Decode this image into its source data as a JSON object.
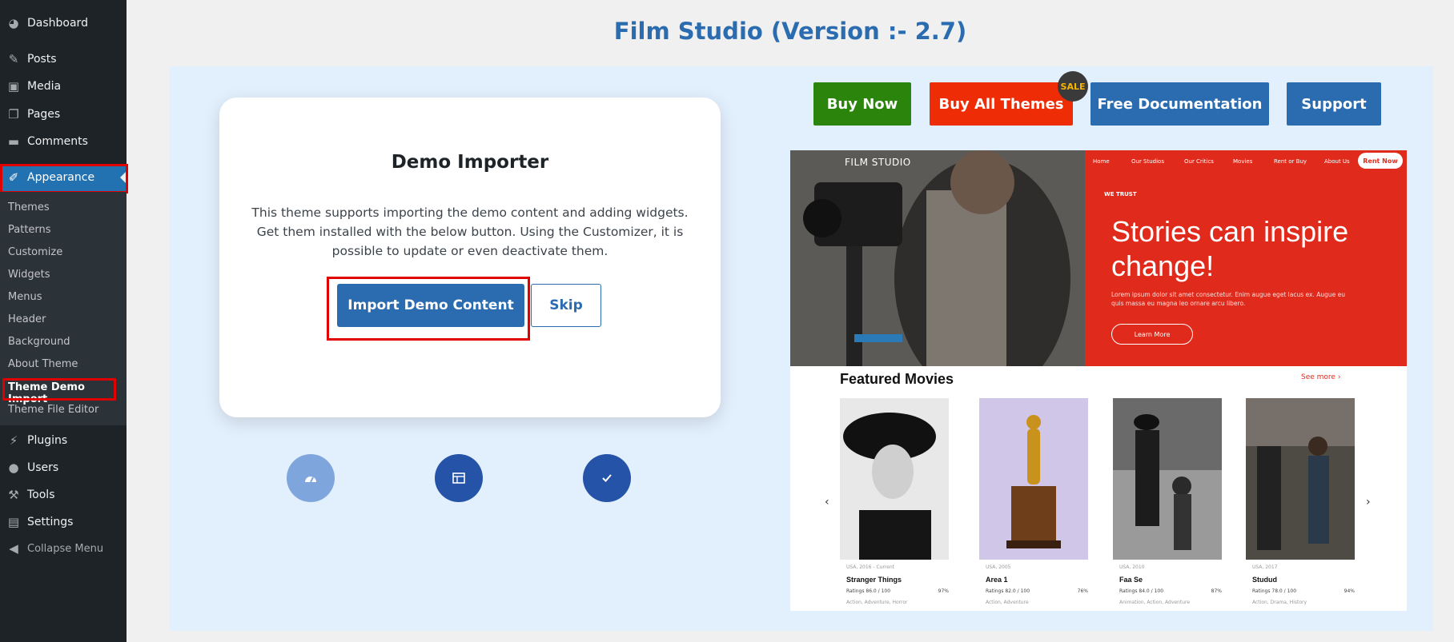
{
  "sidebar": {
    "menu": [
      {
        "label": "Dashboard",
        "icon": "dashboard-icon"
      },
      {
        "label": "Posts",
        "icon": "pin-icon"
      },
      {
        "label": "Media",
        "icon": "media-icon"
      },
      {
        "label": "Pages",
        "icon": "pages-icon"
      },
      {
        "label": "Comments",
        "icon": "comment-icon"
      },
      {
        "label": "Appearance",
        "icon": "brush-icon"
      }
    ],
    "submenu": [
      "Themes",
      "Patterns",
      "Customize",
      "Widgets",
      "Menus",
      "Header",
      "Background",
      "About Theme",
      "Theme Demo Import",
      "Theme File Editor"
    ],
    "menu2": [
      {
        "label": "Plugins",
        "icon": "plug-icon"
      },
      {
        "label": "Users",
        "icon": "user-icon"
      },
      {
        "label": "Tools",
        "icon": "wrench-icon"
      },
      {
        "label": "Settings",
        "icon": "settings-icon"
      }
    ],
    "collapse_label": "Collapse Menu"
  },
  "page_title": "Film Studio (Version :- 2.7)",
  "importer": {
    "title": "Demo Importer",
    "description": "This theme supports importing the demo content and adding widgets. Get them installed with the below button. Using the Customizer, it is possible to update or even deactivate them.",
    "import_label": "Import Demo Content",
    "skip_label": "Skip"
  },
  "steps": [
    {
      "icon": "gauge-icon"
    },
    {
      "icon": "table-icon"
    },
    {
      "icon": "check-icon"
    }
  ],
  "top_buttons": {
    "buy_now": "Buy Now",
    "buy_all": "Buy All Themes",
    "sale_badge": "SALE",
    "docs": "Free Documentation",
    "support": "Support"
  },
  "preview": {
    "logo": "FILM STUDIO",
    "nav": [
      "Home",
      "Our Studios",
      "Our Critics",
      "Movies",
      "Rent or Buy",
      "About Us"
    ],
    "rent_now": "Rent Now",
    "eyebrow": "WE TRUST",
    "heading": "Stories can inspire change!",
    "hero_text": "Lorem ipsum dolor sit amet consectetur. Enim augue eget lacus ex. Augue eu quis massa eu magna leo ornare arcu libero.",
    "learn_more": "Learn More",
    "featured_title": "Featured Movies",
    "see_more": "See more",
    "movies": [
      {
        "meta": "USA, 2016 - Current",
        "title": "Stranger Things",
        "rating": "Ratings 86.0 / 100",
        "pct": "97%",
        "genre": "Action, Adventure, Horror"
      },
      {
        "meta": "USA, 2005",
        "title": "Area 1",
        "rating": "Ratings 82.0 / 100",
        "pct": "76%",
        "genre": "Action, Adventure"
      },
      {
        "meta": "USA, 2010",
        "title": "Faa Se",
        "rating": "Ratings 84.0 / 100",
        "pct": "87%",
        "genre": "Animation, Action, Adventure"
      },
      {
        "meta": "USA, 2017",
        "title": "Studud",
        "rating": "Ratings 78.0 / 100",
        "pct": "94%",
        "genre": "Action, Drama, History"
      }
    ]
  },
  "colors": {
    "sidebar_bg": "#1d2327",
    "accent": "#2271b1",
    "primary_button": "#2b6cb0",
    "buy_now": "#2b840b",
    "buy_all": "#ee2d07",
    "highlight_red": "#e00000",
    "hero_red": "#e02a1b"
  }
}
